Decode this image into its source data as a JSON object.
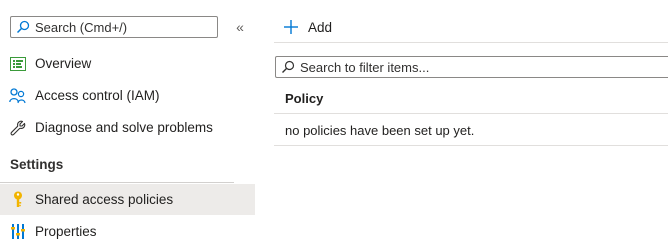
{
  "sidebar": {
    "search": {
      "placeholder": "Search (Cmd+/)"
    },
    "collapse_glyph": "«",
    "items": [
      {
        "label": "Overview",
        "icon": "overview-icon"
      },
      {
        "label": "Access control (IAM)",
        "icon": "people-icon"
      },
      {
        "label": "Diagnose and solve problems",
        "icon": "wrench-icon"
      }
    ],
    "section_header": "Settings",
    "settings_items": [
      {
        "label": "Shared access policies",
        "icon": "key-icon",
        "selected": true
      },
      {
        "label": "Properties",
        "icon": "properties-icon"
      }
    ]
  },
  "toolbar": {
    "add_label": "Add"
  },
  "filter": {
    "placeholder": "Search to filter items..."
  },
  "table": {
    "columns": [
      "Policy"
    ],
    "empty_message": "no policies have been set up yet."
  },
  "colors": {
    "accent": "#0078d4",
    "selected_bg": "#edebe9",
    "key": "#f2b400"
  }
}
